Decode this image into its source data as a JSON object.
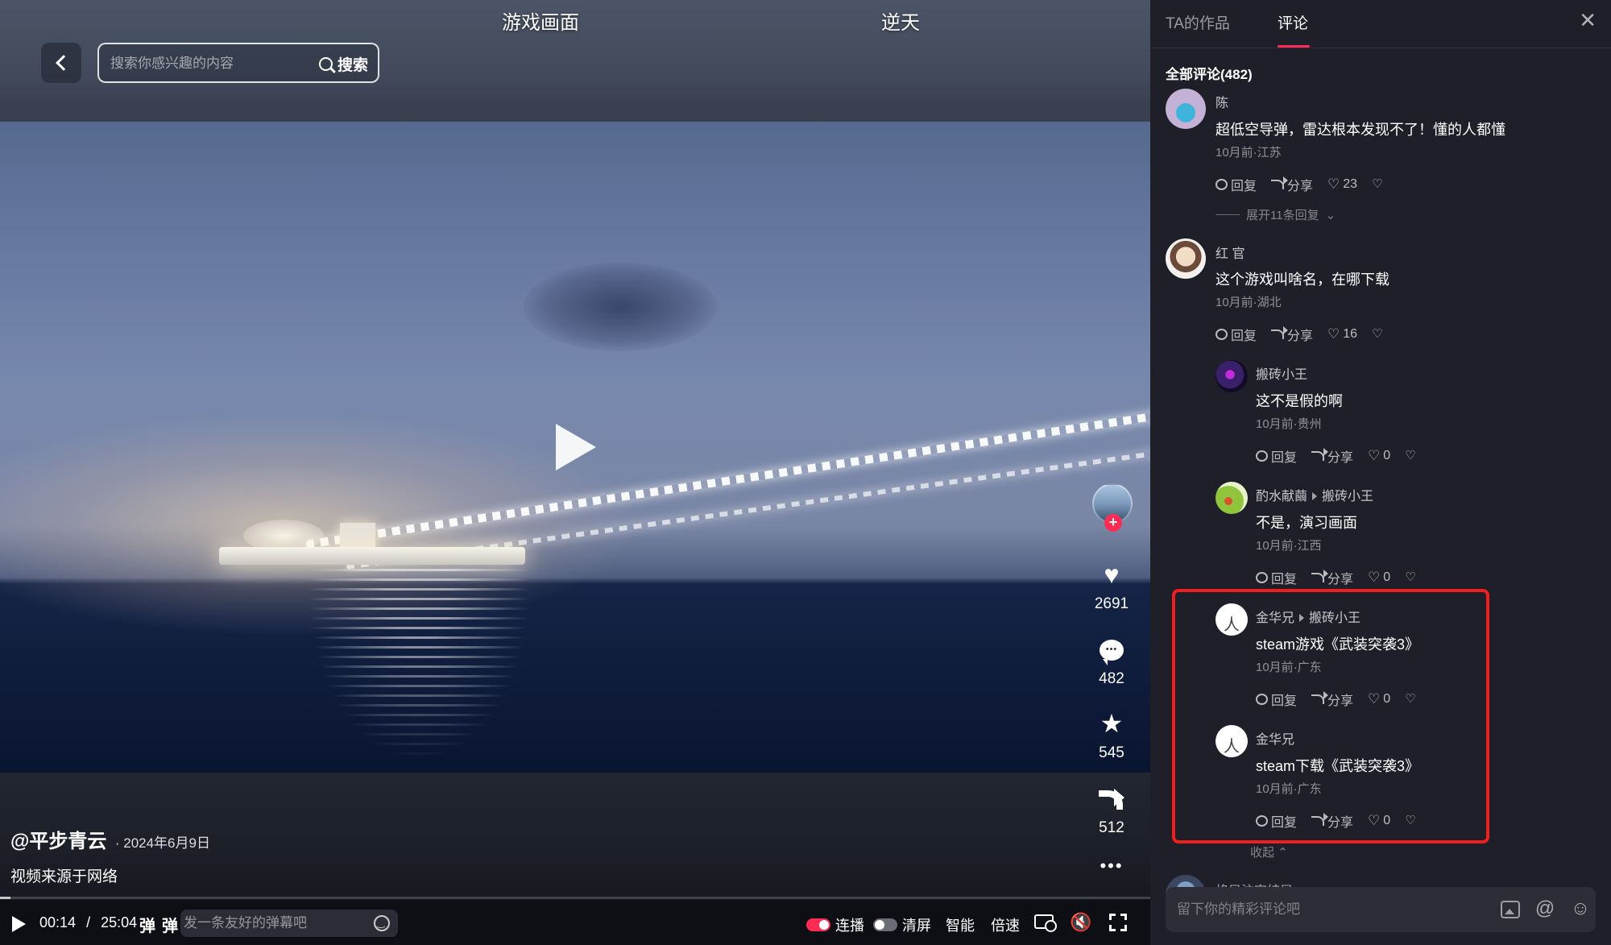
{
  "video": {
    "top_tabs": [
      "游戏画面",
      "逆天"
    ],
    "search": {
      "placeholder": "搜索你感兴趣的内容",
      "button_label": "搜索"
    },
    "actions": {
      "likes": "2691",
      "comments": "482",
      "favorites": "545",
      "shares": "512"
    },
    "author": "@平步青云",
    "date": "· 2024年6月9日",
    "description": "视频来源于网络",
    "player": {
      "current_time": "00:14",
      "separator": "/",
      "duration": "25:04",
      "progress_fraction": 0.0093,
      "danmu_icon_1": "弹",
      "danmu_icon_2": "弹",
      "danmu_placeholder": "发一条友好的弹幕吧",
      "autoplay_label": "连播",
      "autoplay_on": true,
      "clear_label": "清屏",
      "clear_on": false,
      "smart_label": "智能",
      "speed_label": "倍速"
    }
  },
  "panel": {
    "tabs": [
      "TA的作品",
      "评论"
    ],
    "active_tab": 1,
    "total_label": "全部评论(482)",
    "expand_label": "展开11条回复",
    "collapse_label": "收起",
    "partial_next_user": "格局注定结局",
    "comment_placeholder": "留下你的精彩评论吧",
    "reply_label": "回复",
    "share_label": "分享",
    "comments": [
      {
        "user": "陈",
        "reply_to": "",
        "text": "超低空导弹，雷达根本发现不了！懂的人都懂",
        "meta": "10月前·江苏",
        "likes": "23"
      },
      {
        "user": "红 官",
        "reply_to": "",
        "text": "这个游戏叫啥名，在哪下载",
        "meta": "10月前·湖北",
        "likes": "16"
      },
      {
        "user": "搬砖小王",
        "reply_to": "",
        "text": "这不是假的啊",
        "meta": "10月前·贵州",
        "likes": "0"
      },
      {
        "user": "酌水献繭",
        "reply_to": "搬砖小王",
        "text": "不是，演习画面",
        "meta": "10月前·江西",
        "likes": "0"
      },
      {
        "user": "金华兄",
        "reply_to": "搬砖小王",
        "text": "steam游戏《武装突袭3》",
        "meta": "10月前·广东",
        "likes": "0"
      },
      {
        "user": "金华兄",
        "reply_to": "",
        "text": "steam下载《武装突袭3》",
        "meta": "10月前·广东",
        "likes": "0"
      }
    ]
  },
  "colors": {
    "accent": "#fe2c55",
    "highlight_box": "#f21e1e",
    "panel_bg": "#1e1f28"
  }
}
